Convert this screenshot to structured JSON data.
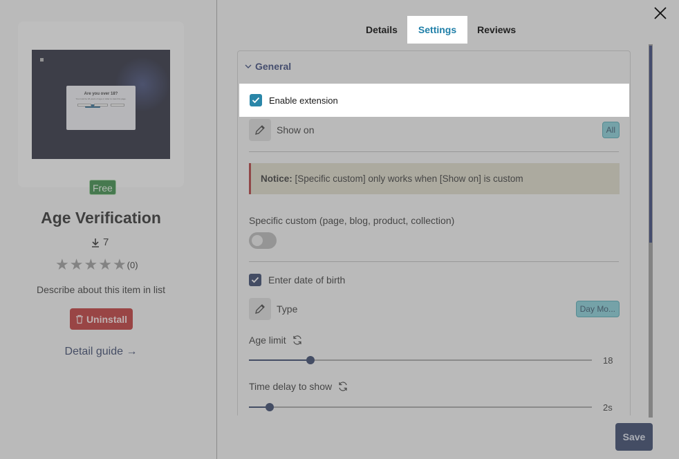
{
  "tabs": [
    {
      "label": "Details"
    },
    {
      "label": "Settings"
    },
    {
      "label": "Reviews"
    }
  ],
  "active_tab": "Settings",
  "item": {
    "badge": "Free",
    "title": "Age Verification",
    "downloads": "7",
    "rating": 0,
    "rating_count": "(0)",
    "description": "Describe about this item in list",
    "uninstall_label": "Uninstall",
    "guide_label": "Detail guide →",
    "thumbnail": {
      "dialog_title": "Are you over 18?",
      "dialog_text": "You must be 18 years of age or older to view this page."
    }
  },
  "settings": {
    "section_title": "General",
    "enable_label": "Enable extension",
    "enable_checked": true,
    "show_on_label": "Show on",
    "show_on_value": "All",
    "notice_bold": "Notice:",
    "notice_text": "[Specific custom] only works when [Show on] is custom",
    "specific_custom_label": "Specific custom (page, blog, product, collection)",
    "specific_custom_on": false,
    "dob_label": "Enter date of birth",
    "dob_checked": true,
    "type_label": "Type",
    "type_value": "Day Mo...",
    "age_limit_label": "Age limit",
    "age_limit_value": "18",
    "age_limit_fraction": 0.18,
    "delay_label": "Time delay to show",
    "delay_value": "2s",
    "delay_fraction": 0.06
  },
  "save_label": "Save",
  "colors": {
    "accent": "#1f7fa8",
    "navy": "#1b2b55",
    "danger": "#b51c1c",
    "success": "#1e7a2f"
  }
}
